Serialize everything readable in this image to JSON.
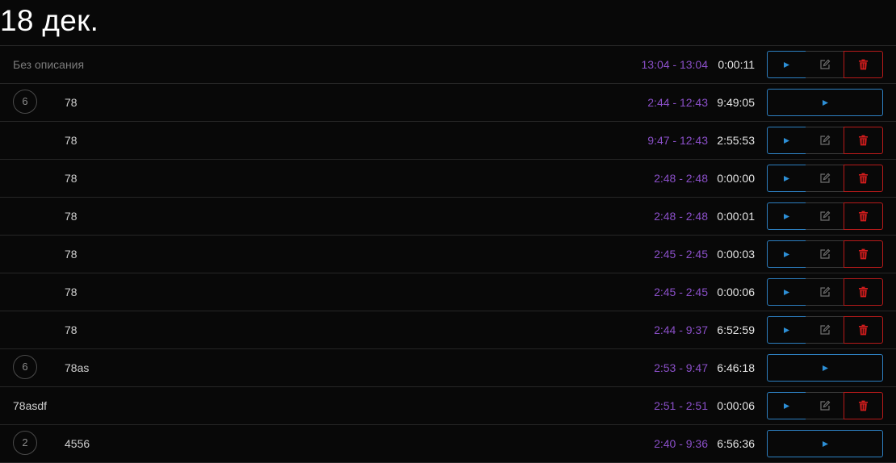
{
  "group": {
    "date_title": "18 дек."
  },
  "entries": [
    {
      "kind": "single-flat",
      "description": "Без описания",
      "muted": true,
      "range": "13:04 - 13:04",
      "duration": "0:00:11"
    },
    {
      "kind": "group",
      "count": "6",
      "description": "78",
      "range": "2:44 - 12:43",
      "duration": "9:49:05"
    },
    {
      "kind": "child",
      "description": "78",
      "range": "9:47 - 12:43",
      "duration": "2:55:53"
    },
    {
      "kind": "child",
      "description": "78",
      "range": "2:48 - 2:48",
      "duration": "0:00:00"
    },
    {
      "kind": "child",
      "description": "78",
      "range": "2:48 - 2:48",
      "duration": "0:00:01"
    },
    {
      "kind": "child",
      "description": "78",
      "range": "2:45 - 2:45",
      "duration": "0:00:03"
    },
    {
      "kind": "child",
      "description": "78",
      "range": "2:45 - 2:45",
      "duration": "0:00:06"
    },
    {
      "kind": "child",
      "description": "78",
      "range": "2:44 - 9:37",
      "duration": "6:52:59"
    },
    {
      "kind": "group",
      "count": "6",
      "description": "78as",
      "range": "2:53 - 9:47",
      "duration": "6:46:18"
    },
    {
      "kind": "single-flat",
      "description": "78asdf",
      "muted": false,
      "range": "2:51 - 2:51",
      "duration": "0:00:06"
    },
    {
      "kind": "group",
      "count": "2",
      "description": "4556",
      "range": "2:40 - 9:36",
      "duration": "6:56:36"
    }
  ],
  "icons": {
    "play": "play-icon",
    "edit": "edit-icon",
    "delete": "trash-icon"
  },
  "colors": {
    "time_range": "#8a4fc8",
    "play": "#2d8fd6",
    "delete": "#d21c1c",
    "edit": "#6f6f6f"
  }
}
